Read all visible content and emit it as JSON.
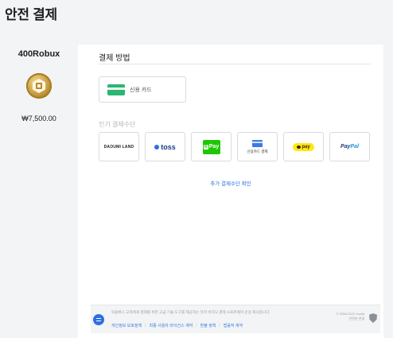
{
  "page": {
    "title": "안전 결제"
  },
  "product": {
    "name": "400Robux",
    "price": "₩7,500.00",
    "icon": "robux-coin-icon"
  },
  "payment": {
    "section_title": "결제 방법",
    "card_option": {
      "label": "신용 카드",
      "icon": "credit-card-icon"
    },
    "popular_title": "인기 결제수단",
    "popular_methods": [
      {
        "label": "DAOUMI LAND"
      },
      {
        "label": "toss"
      },
      {
        "label": "Pay",
        "badge": "N"
      },
      {
        "label": "신용카드 결제"
      },
      {
        "label": "pay"
      },
      {
        "pay": "Pay",
        "pal": "Pal"
      }
    ],
    "more_link": "추가 결제수단 확인"
  },
  "footer": {
    "notice": "락블록스 고객에게 결제를 위한 고급 기술 도구를 제공하는 유저 비지오 결제 소프트웨어 운용 회사입니다.",
    "links": [
      "개인정보 보호정책",
      "최종 사용자 라이선스 계약",
      "환불 정책",
      "법률적 계약"
    ],
    "copyright_line1": "© 2008-2022 Xsolla",
    "copyright_line2": "안전한 연결"
  },
  "colors": {
    "accent": "#2f6fe4",
    "card_green": "#2bb673",
    "naver_green": "#1ec800",
    "kakao_yellow": "#ffe812"
  }
}
